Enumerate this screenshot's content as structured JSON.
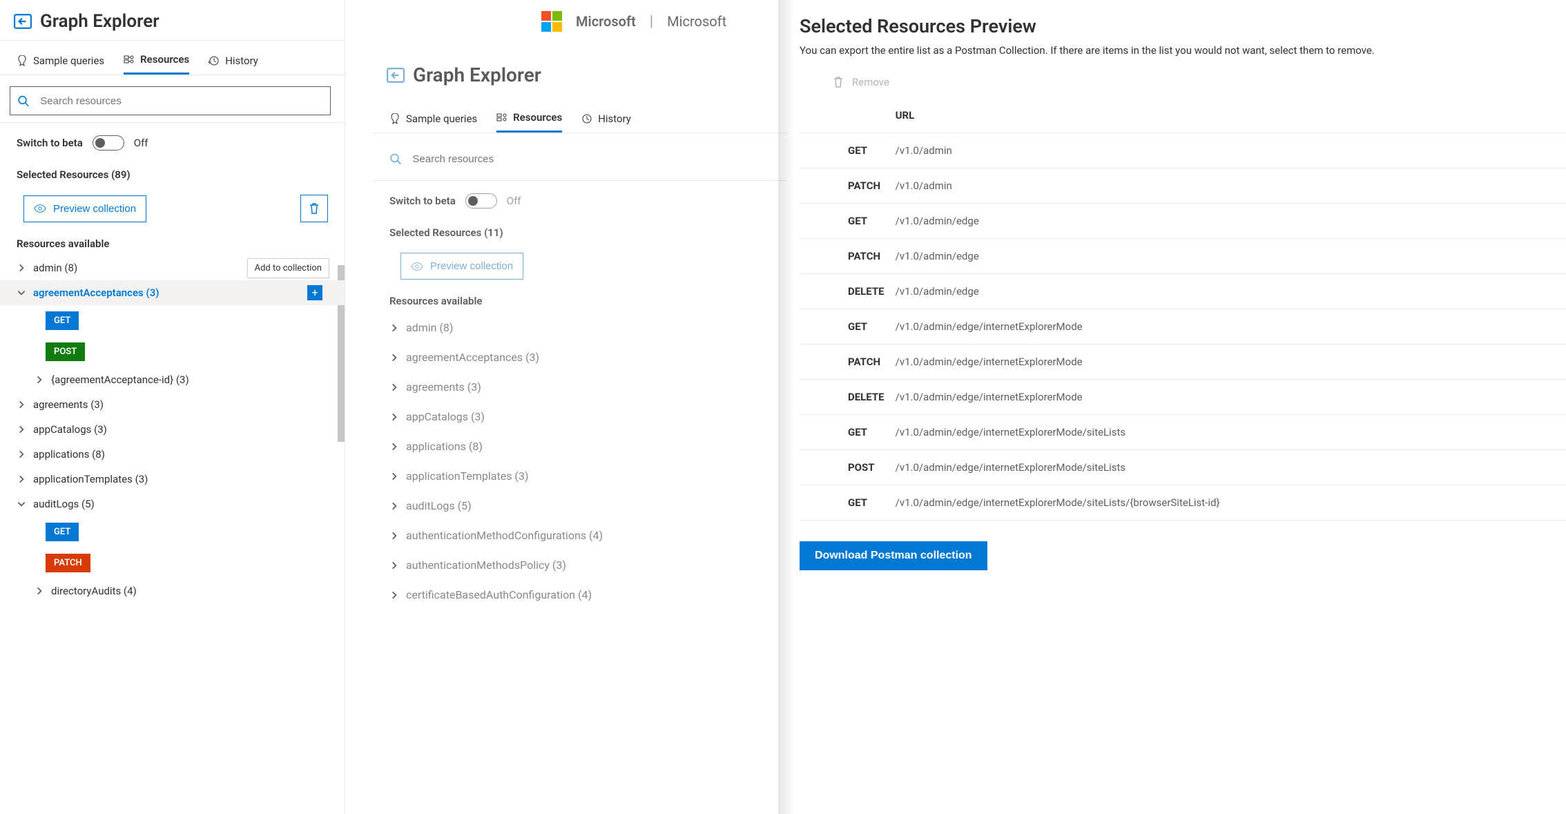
{
  "brand": {
    "name": "Microsoft",
    "subBrand": "Microsoft"
  },
  "leftPanel": {
    "title": "Graph Explorer",
    "tabs": [
      {
        "label": "Sample queries",
        "active": false
      },
      {
        "label": "Resources",
        "active": true
      },
      {
        "label": "History",
        "active": false
      }
    ],
    "searchPlaceholder": "Search resources",
    "switch": {
      "label": "Switch to beta",
      "state": "Off"
    },
    "selectedTitle": "Selected Resources (89)",
    "previewBtn": "Preview collection",
    "resourcesTitle": "Resources available",
    "addTooltip": "Add to collection",
    "tree": [
      {
        "label": "admin (8)",
        "expanded": false
      },
      {
        "label": "agreementAcceptances (3)",
        "expanded": true,
        "active": true,
        "withAdd": true,
        "children": [
          {
            "method": "GET"
          },
          {
            "method": "POST"
          },
          {
            "label": "{agreementAcceptance-id} (3)",
            "child": true
          }
        ]
      },
      {
        "label": "agreements (3)"
      },
      {
        "label": "appCatalogs (3)"
      },
      {
        "label": "applications (8)"
      },
      {
        "label": "applicationTemplates (3)"
      },
      {
        "label": "auditLogs (5)",
        "expanded": true,
        "children": [
          {
            "method": "GET"
          },
          {
            "method": "PATCH"
          },
          {
            "label": "directoryAudits (4)",
            "child": true
          }
        ]
      }
    ]
  },
  "midPanel": {
    "title": "Graph Explorer",
    "tabs": [
      {
        "label": "Sample queries",
        "active": false
      },
      {
        "label": "Resources",
        "active": true
      },
      {
        "label": "History",
        "active": false
      }
    ],
    "searchPlaceholder": "Search resources",
    "switch": {
      "label": "Switch to beta",
      "state": "Off"
    },
    "selectedTitle": "Selected Resources (11)",
    "previewBtn": "Preview collection",
    "resourcesTitle": "Resources available",
    "tree": [
      {
        "label": "admin (8)"
      },
      {
        "label": "agreementAcceptances (3)"
      },
      {
        "label": "agreements (3)"
      },
      {
        "label": "appCatalogs (3)"
      },
      {
        "label": "applications (8)"
      },
      {
        "label": "applicationTemplates (3)"
      },
      {
        "label": "auditLogs (5)"
      },
      {
        "label": "authenticationMethodConfigurations (4)"
      },
      {
        "label": "authenticationMethodsPolicy (3)"
      },
      {
        "label": "certificateBasedAuthConfiguration (4)"
      }
    ]
  },
  "rightPanel": {
    "title": "Selected Resources Preview",
    "subtitle": "You can export the entire list as a Postman Collection. If there are items in the list you would not want, select them to remove.",
    "removeLabel": "Remove",
    "urlHeader": "URL",
    "rows": [
      {
        "method": "GET",
        "url": "/v1.0/admin"
      },
      {
        "method": "PATCH",
        "url": "/v1.0/admin"
      },
      {
        "method": "GET",
        "url": "/v1.0/admin/edge"
      },
      {
        "method": "PATCH",
        "url": "/v1.0/admin/edge"
      },
      {
        "method": "DELETE",
        "url": "/v1.0/admin/edge"
      },
      {
        "method": "GET",
        "url": "/v1.0/admin/edge/internetExplorerMode"
      },
      {
        "method": "PATCH",
        "url": "/v1.0/admin/edge/internetExplorerMode"
      },
      {
        "method": "DELETE",
        "url": "/v1.0/admin/edge/internetExplorerMode"
      },
      {
        "method": "GET",
        "url": "/v1.0/admin/edge/internetExplorerMode/siteLists"
      },
      {
        "method": "POST",
        "url": "/v1.0/admin/edge/internetExplorerMode/siteLists"
      },
      {
        "method": "GET",
        "url": "/v1.0/admin/edge/internetExplorerMode/siteLists/{browserSiteList-id}"
      }
    ],
    "downloadBtn": "Download Postman collection"
  }
}
